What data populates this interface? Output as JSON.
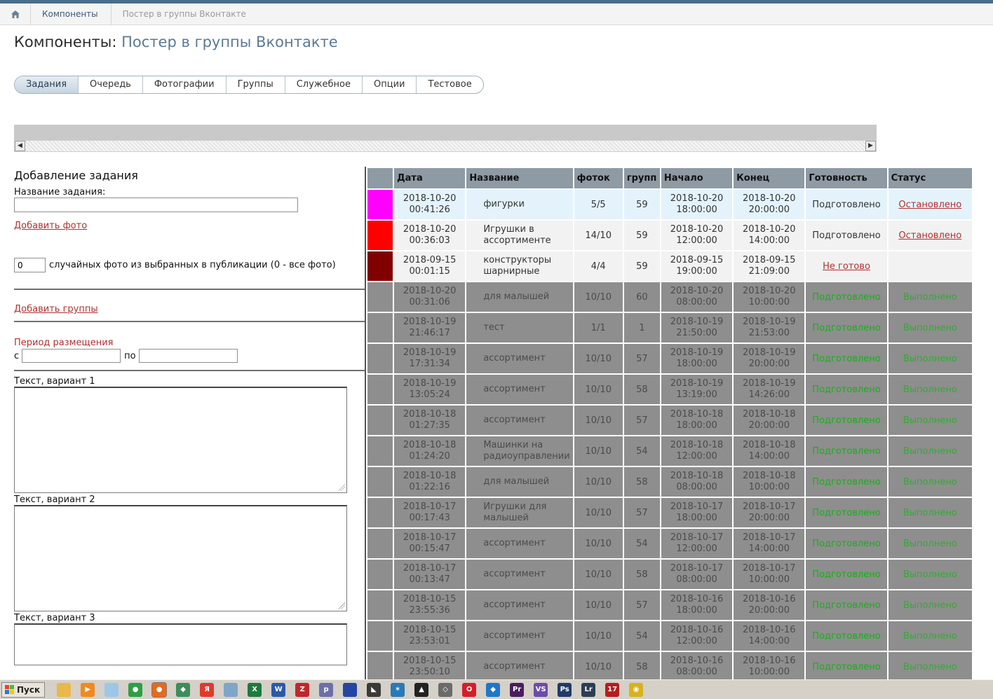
{
  "breadcrumb": {
    "items": [
      "Компоненты",
      "Постер в группы Вконтакте"
    ]
  },
  "page_title": {
    "main": "Компоненты:",
    "sub": "Постер в группы Вконтакте"
  },
  "tabs": [
    "Задания",
    "Очередь",
    "Фотографии",
    "Группы",
    "Служебное",
    "Опции",
    "Тестовое"
  ],
  "active_tab": "Задания",
  "form": {
    "heading": "Добавление задания",
    "name_label": "Название задания:",
    "name_value": "",
    "add_photo": "Добавить фото",
    "random_count": "0",
    "random_label": "случайных фото из выбранных в публикации (0 - все фото)",
    "add_groups": "Добавить группы",
    "period_label": "Период размещения",
    "from_label": "с",
    "to_label": "по",
    "text1_label": "Текст, вариант 1",
    "text2_label": "Текст, вариант 2",
    "text3_label": "Текст, вариант 3"
  },
  "table": {
    "headers": [
      "",
      "Дата",
      "Название",
      "фоток",
      "групп",
      "Начало",
      "Конец",
      "Готовность",
      "Статус"
    ],
    "rows": [
      {
        "color": "#ff00ff",
        "state": "active",
        "date": "2018-10-20",
        "time": "00:41:26",
        "name": "фигурки",
        "photos": "5/5",
        "groups": "59",
        "start_date": "2018-10-20",
        "start_time": "18:00:00",
        "end_date": "2018-10-20",
        "end_time": "20:00:00",
        "ready": "Подготовлено",
        "status": "Остановлено"
      },
      {
        "color": "#ff0000",
        "state": "active",
        "date": "2018-10-20",
        "time": "00:36:03",
        "name": "Игрушки в ассортименте",
        "photos": "14/10",
        "groups": "59",
        "start_date": "2018-10-20",
        "start_time": "12:00:00",
        "end_date": "2018-10-20",
        "end_time": "14:00:00",
        "ready": "Подготовлено",
        "status": "Остановлено"
      },
      {
        "color": "#800000",
        "state": "active",
        "date": "2018-09-15",
        "time": "00:01:15",
        "name": "конструкторы шарнирные",
        "photos": "4/4",
        "groups": "59",
        "start_date": "2018-09-15",
        "start_time": "19:00:00",
        "end_date": "2018-09-15",
        "end_time": "21:09:00",
        "ready": "Не готово",
        "status": ""
      },
      {
        "color": "#8e8e8e",
        "state": "done",
        "date": "2018-10-20",
        "time": "00:31:06",
        "name": "для малышей",
        "photos": "10/10",
        "groups": "60",
        "start_date": "2018-10-20",
        "start_time": "08:00:00",
        "end_date": "2018-10-20",
        "end_time": "10:00:00",
        "ready": "Подготовлено",
        "status": "Выполнено"
      },
      {
        "color": "#8e8e8e",
        "state": "done",
        "date": "2018-10-19",
        "time": "21:46:17",
        "name": "тест",
        "photos": "1/1",
        "groups": "1",
        "start_date": "2018-10-19",
        "start_time": "21:50:00",
        "end_date": "2018-10-19",
        "end_time": "21:53:00",
        "ready": "Подготовлено",
        "status": "Выполнено"
      },
      {
        "color": "#8e8e8e",
        "state": "done",
        "date": "2018-10-19",
        "time": "17:31:34",
        "name": "ассортимент",
        "photos": "10/10",
        "groups": "57",
        "start_date": "2018-10-19",
        "start_time": "18:00:00",
        "end_date": "2018-10-19",
        "end_time": "20:00:00",
        "ready": "Подготовлено",
        "status": "Выполнено"
      },
      {
        "color": "#8e8e8e",
        "state": "done",
        "date": "2018-10-19",
        "time": "13:05:24",
        "name": "ассортимент",
        "photos": "10/10",
        "groups": "58",
        "start_date": "2018-10-19",
        "start_time": "13:19:00",
        "end_date": "2018-10-19",
        "end_time": "14:26:00",
        "ready": "Подготовлено",
        "status": "Выполнено"
      },
      {
        "color": "#8e8e8e",
        "state": "done",
        "date": "2018-10-18",
        "time": "01:27:35",
        "name": "ассортимент",
        "photos": "10/10",
        "groups": "57",
        "start_date": "2018-10-18",
        "start_time": "18:00:00",
        "end_date": "2018-10-18",
        "end_time": "20:00:00",
        "ready": "Подготовлено",
        "status": "Выполнено"
      },
      {
        "color": "#8e8e8e",
        "state": "done",
        "date": "2018-10-18",
        "time": "01:24:20",
        "name": "Машинки на радиоуправлении",
        "photos": "10/10",
        "groups": "54",
        "start_date": "2018-10-18",
        "start_time": "12:00:00",
        "end_date": "2018-10-18",
        "end_time": "14:00:00",
        "ready": "Подготовлено",
        "status": "Выполнено"
      },
      {
        "color": "#8e8e8e",
        "state": "done",
        "date": "2018-10-18",
        "time": "01:22:16",
        "name": "для малышей",
        "photos": "10/10",
        "groups": "58",
        "start_date": "2018-10-18",
        "start_time": "08:00:00",
        "end_date": "2018-10-18",
        "end_time": "10:00:00",
        "ready": "Подготовлено",
        "status": "Выполнено"
      },
      {
        "color": "#8e8e8e",
        "state": "done",
        "date": "2018-10-17",
        "time": "00:17:43",
        "name": "Игрушки для малышей",
        "photos": "10/10",
        "groups": "57",
        "start_date": "2018-10-17",
        "start_time": "18:00:00",
        "end_date": "2018-10-17",
        "end_time": "20:00:00",
        "ready": "Подготовлено",
        "status": "Выполнено"
      },
      {
        "color": "#8e8e8e",
        "state": "done",
        "date": "2018-10-17",
        "time": "00:15:47",
        "name": "ассортимент",
        "photos": "10/10",
        "groups": "54",
        "start_date": "2018-10-17",
        "start_time": "12:00:00",
        "end_date": "2018-10-17",
        "end_time": "14:00:00",
        "ready": "Подготовлено",
        "status": "Выполнено"
      },
      {
        "color": "#8e8e8e",
        "state": "done",
        "date": "2018-10-17",
        "time": "00:13:47",
        "name": "ассортимент",
        "photos": "10/10",
        "groups": "58",
        "start_date": "2018-10-17",
        "start_time": "08:00:00",
        "end_date": "2018-10-17",
        "end_time": "10:00:00",
        "ready": "Подготовлено",
        "status": "Выполнено"
      },
      {
        "color": "#8e8e8e",
        "state": "done",
        "date": "2018-10-15",
        "time": "23:55:36",
        "name": "ассортимент",
        "photos": "10/10",
        "groups": "57",
        "start_date": "2018-10-16",
        "start_time": "18:00:00",
        "end_date": "2018-10-16",
        "end_time": "20:00:00",
        "ready": "Подготовлено",
        "status": "Выполнено"
      },
      {
        "color": "#8e8e8e",
        "state": "done",
        "date": "2018-10-15",
        "time": "23:53:01",
        "name": "ассортимент",
        "photos": "10/10",
        "groups": "54",
        "start_date": "2018-10-16",
        "start_time": "12:00:00",
        "end_date": "2018-10-16",
        "end_time": "14:00:00",
        "ready": "Подготовлено",
        "status": "Выполнено"
      },
      {
        "color": "#8e8e8e",
        "state": "done",
        "date": "2018-10-15",
        "time": "23:50:10",
        "name": "ассортимент",
        "photos": "10/10",
        "groups": "58",
        "start_date": "2018-10-16",
        "start_time": "08:00:00",
        "end_date": "2018-10-16",
        "end_time": "10:00:00",
        "ready": "Подготовлено",
        "status": "Выполнено"
      }
    ]
  },
  "taskbar": {
    "start_label": "Пуск",
    "icons": [
      {
        "name": "folder-icon",
        "glyph": "",
        "color": "#e8b84a"
      },
      {
        "name": "media-player-icon",
        "glyph": "▶",
        "color": "#f08a20"
      },
      {
        "name": "notepad-icon",
        "glyph": "",
        "color": "#9ec6e8"
      },
      {
        "name": "chrome-icon",
        "glyph": "●",
        "color": "#2f9e44"
      },
      {
        "name": "firefox-icon",
        "glyph": "●",
        "color": "#e66a1e"
      },
      {
        "name": "app-icon",
        "glyph": "◆",
        "color": "#3d8d5a"
      },
      {
        "name": "yandex-icon",
        "glyph": "Я",
        "color": "#e03a2b"
      },
      {
        "name": "calculator-icon",
        "glyph": "",
        "color": "#7fa6c8"
      },
      {
        "name": "excel-icon",
        "glyph": "X",
        "color": "#1d7a3c"
      },
      {
        "name": "word-icon",
        "glyph": "W",
        "color": "#2b5aa8"
      },
      {
        "name": "filezilla-icon",
        "glyph": "Z",
        "color": "#c0282a"
      },
      {
        "name": "php-icon",
        "glyph": "p",
        "color": "#6d6fa8"
      },
      {
        "name": "book-icon",
        "glyph": "",
        "color": "#2546a0"
      },
      {
        "name": "tool-icon",
        "glyph": "◣",
        "color": "#3a3a3a"
      },
      {
        "name": "star-icon",
        "glyph": "✶",
        "color": "#2a79b8"
      },
      {
        "name": "hat-icon",
        "glyph": "▲",
        "color": "#222222"
      },
      {
        "name": "key-icon",
        "glyph": "◇",
        "color": "#6b6b6b"
      },
      {
        "name": "opera-icon",
        "glyph": "O",
        "color": "#d41e2a"
      },
      {
        "name": "shield-icon",
        "glyph": "◆",
        "color": "#1e77c8"
      },
      {
        "name": "premiere-icon",
        "glyph": "Pr",
        "color": "#4a1e5e"
      },
      {
        "name": "visual-studio-icon",
        "glyph": "VS",
        "color": "#6b4da8"
      },
      {
        "name": "photoshop-icon",
        "glyph": "Ps",
        "color": "#1e3d66"
      },
      {
        "name": "lightroom-icon",
        "glyph": "Lr",
        "color": "#2b3e55"
      },
      {
        "name": "app-2017-icon",
        "glyph": "17",
        "color": "#b51e1e"
      },
      {
        "name": "cat-icon",
        "glyph": "◉",
        "color": "#d8b21e"
      }
    ]
  }
}
